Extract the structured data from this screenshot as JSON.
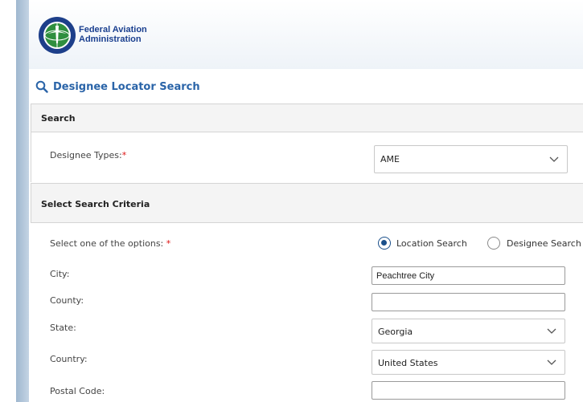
{
  "header": {
    "agency_line1": "Federal Aviation",
    "agency_line2": "Administration",
    "logo_icon": "faa-seal-icon"
  },
  "page": {
    "title": "Designee Locator Search",
    "title_icon": "search-icon"
  },
  "search_section": {
    "heading": "Search",
    "designee_types_label": "Designee Types:",
    "required_mark": "*",
    "designee_type_value": "AME"
  },
  "criteria_section": {
    "heading": "Select Search Criteria",
    "options_label": "Select one of the options: ",
    "required_mark": "*",
    "options": [
      {
        "label": "Location Search",
        "selected": true
      },
      {
        "label": "Designee Search",
        "selected": false
      }
    ]
  },
  "fields": {
    "city_label": "City:",
    "city_value": "Peachtree City",
    "county_label": "County:",
    "county_value": "",
    "state_label": "State:",
    "state_value": "Georgia",
    "country_label": "Country:",
    "country_value": "United States",
    "postal_label": "Postal Code:",
    "postal_value": ""
  },
  "colors": {
    "title_blue": "#2a64a8",
    "brand_navy": "#1a3f8f",
    "radio_selected": "#1a4f8a",
    "required_red": "#dd1111"
  }
}
